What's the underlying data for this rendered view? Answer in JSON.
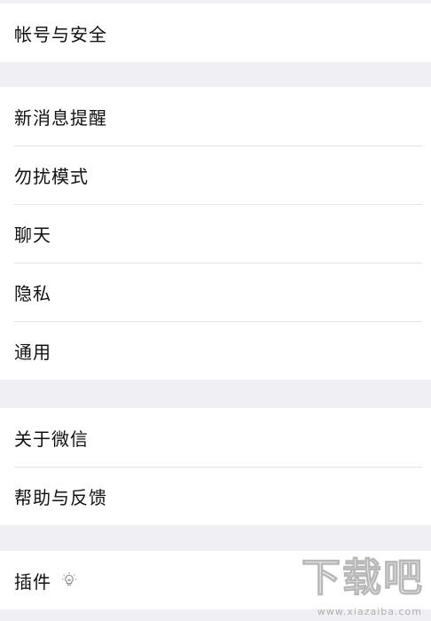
{
  "settings": {
    "group1": [
      {
        "label": "帐号与安全"
      }
    ],
    "group2": [
      {
        "label": "新消息提醒"
      },
      {
        "label": "勿扰模式"
      },
      {
        "label": "聊天"
      },
      {
        "label": "隐私"
      },
      {
        "label": "通用"
      }
    ],
    "group3": [
      {
        "label": "关于微信"
      },
      {
        "label": "帮助与反馈"
      }
    ],
    "group4": [
      {
        "label": "插件",
        "icon": "lightbulb-icon"
      }
    ]
  },
  "watermark": {
    "text": "下载吧",
    "url": "www.xiazaiba.com"
  },
  "colors": {
    "background": "#efeff4",
    "row_background": "#ffffff",
    "text": "#111111",
    "divider": "#e3e3e6"
  }
}
